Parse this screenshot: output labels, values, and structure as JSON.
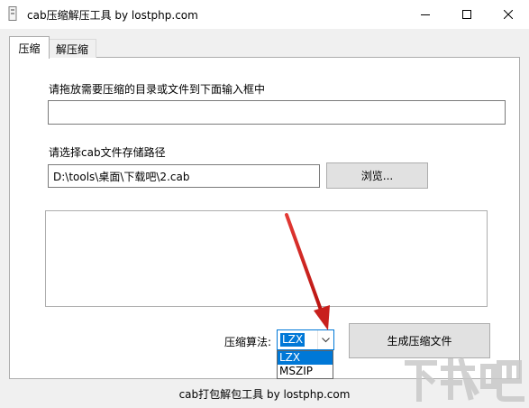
{
  "window": {
    "title": "cab压缩解压工具 by lostphp.com"
  },
  "tabs": [
    {
      "label": "压缩",
      "active": true
    },
    {
      "label": "解压缩",
      "active": false
    }
  ],
  "compress": {
    "source_label": "请拖放需要压缩的目录或文件到下面输入框中",
    "source_value": "",
    "dest_label": "请选择cab文件存储路径",
    "dest_value": "D:\\tools\\桌面\\下载吧\\2.cab",
    "browse_label": "浏览...",
    "log_value": "",
    "algorithm_label": "压缩算法:",
    "algorithm_selected": "LZX",
    "algorithm_options": [
      "LZX",
      "MSZIP"
    ],
    "generate_label": "生成压缩文件"
  },
  "footer": {
    "text": "cab打包解包工具 by lostphp.com"
  },
  "colors": {
    "accent": "#0078d7",
    "annotation_arrow": "#d9201f",
    "watermark": "#c8c8c8"
  },
  "icons": {
    "app": "cabinet-file-icon",
    "minimize": "minimize-icon",
    "maximize": "maximize-icon",
    "close": "close-icon",
    "dropdown": "chevron-down-icon"
  }
}
